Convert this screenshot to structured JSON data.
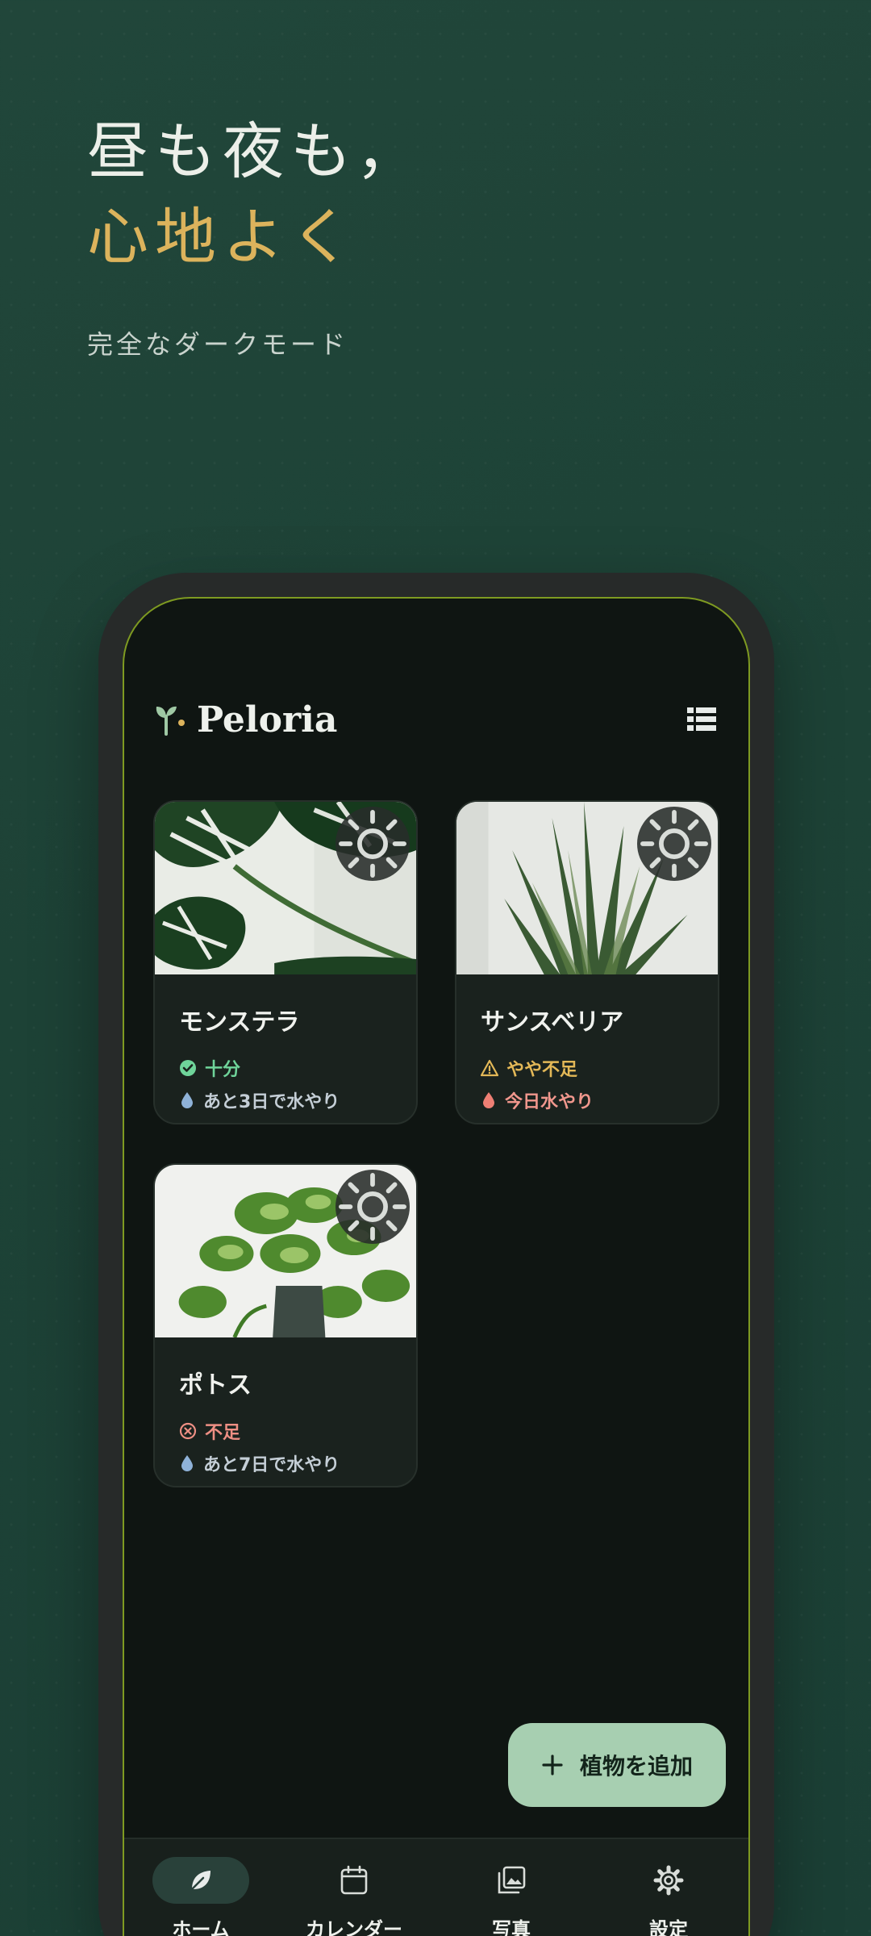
{
  "hero": {
    "line1": "昼も夜も，",
    "line2": "心地よく",
    "subtitle": "完全なダークモード"
  },
  "app": {
    "name": "Peloria",
    "plants": [
      {
        "name": "モンステラ",
        "status": "十分",
        "status_color": "#6fd49a",
        "water": "あと3日で水やり",
        "water_color": "#c4ced6"
      },
      {
        "name": "サンスベリア",
        "status": "やや不足",
        "status_color": "#e3b857",
        "water": "今日水やり",
        "water_color": "#f1978d"
      },
      {
        "name": "ポトス",
        "status": "不足",
        "status_color": "#ee8f84",
        "water": "あと7日で水やり",
        "water_color": "#c4ced6"
      }
    ],
    "add_button_label": "植物を追加",
    "nav": [
      {
        "label": "ホーム",
        "icon": "leaf-icon",
        "active": true
      },
      {
        "label": "カレンダー",
        "icon": "calendar-icon",
        "active": false
      },
      {
        "label": "写真",
        "icon": "photos-icon",
        "active": false
      },
      {
        "label": "設定",
        "icon": "gear-icon",
        "active": false
      }
    ]
  },
  "colors": {
    "background": "#1d4236",
    "accent_gold": "#dcb35c",
    "fab": "#a7cfb1",
    "screen": "#0f1512"
  }
}
